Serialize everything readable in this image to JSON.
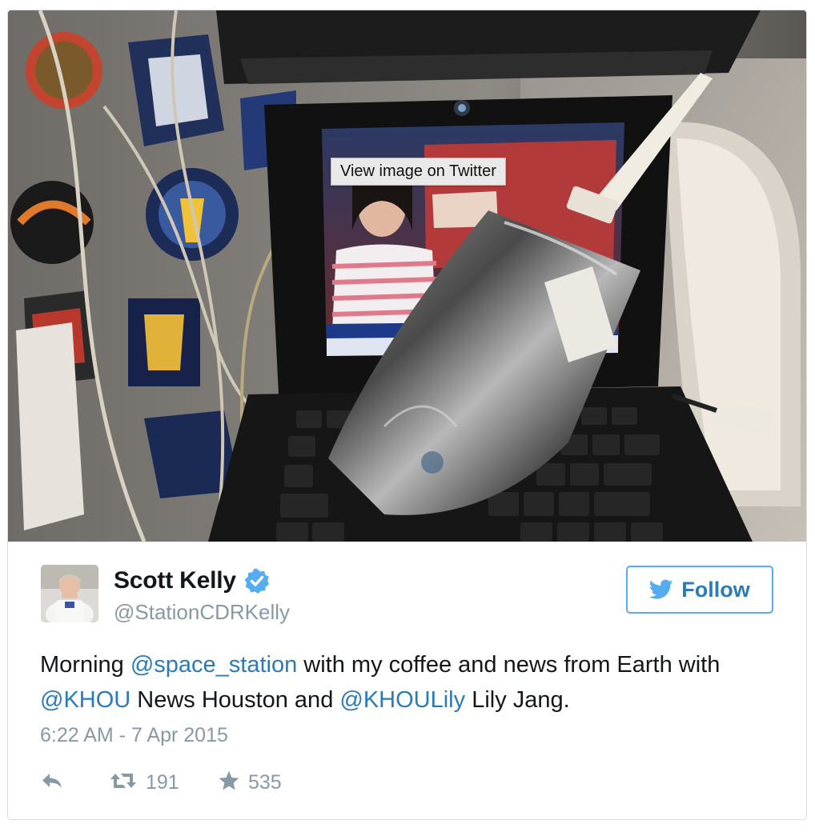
{
  "media": {
    "tooltip": "View image on Twitter"
  },
  "author": {
    "name": "Scott Kelly",
    "handle": "@StationCDRKelly",
    "verified": true
  },
  "follow_button": {
    "label": "Follow",
    "icon": "twitter-bird-icon",
    "color": "#55acee"
  },
  "tweet": {
    "segments": [
      {
        "text": "Morning ",
        "type": "text"
      },
      {
        "text": "@space_station",
        "type": "mention"
      },
      {
        "text": " with my coffee and news from Earth with ",
        "type": "text"
      },
      {
        "text": "@KHOU",
        "type": "mention"
      },
      {
        "text": " News Houston and ",
        "type": "text"
      },
      {
        "text": "@KHOULily",
        "type": "mention"
      },
      {
        "text": " Lily Jang.",
        "type": "text"
      }
    ],
    "timestamp": "6:22 AM - 7 Apr 2015"
  },
  "actions": {
    "reply_icon": "reply-icon",
    "retweet_icon": "retweet-icon",
    "retweet_count": "191",
    "like_icon": "star-icon",
    "like_count": "535"
  },
  "colors": {
    "link": "#2b7bb9",
    "muted": "#8899a6",
    "text": "#14171a",
    "border": "#d8dde1"
  }
}
